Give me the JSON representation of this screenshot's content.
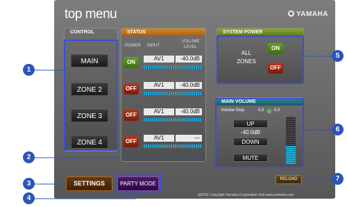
{
  "app": {
    "title": "top menu",
    "brand": "YAMAHA"
  },
  "control": {
    "title": "CONTROL",
    "zones": [
      "MAIN",
      "ZONE 2",
      "ZONE 3",
      "ZONE 4"
    ]
  },
  "status": {
    "title": "STATUS",
    "headers": {
      "power": "POWER",
      "input": "INPUT",
      "volume": "VOLUME",
      "level": "LEVEL"
    },
    "rows": [
      {
        "power": "ON",
        "input": "AV1",
        "volume": "-40.0dB"
      },
      {
        "power": "OFF",
        "input": "AV1",
        "volume": "-40.0dB"
      },
      {
        "power": "OFF",
        "input": "AV1",
        "volume": "-40.0dB"
      },
      {
        "power": "OFF",
        "input": "AV1",
        "volume": "---"
      }
    ]
  },
  "system_power": {
    "title": "SYSTEM POWER",
    "label_line1": "ALL",
    "label_line2": "ZONES",
    "on": "ON",
    "off": "OFF"
  },
  "main_volume": {
    "title": "MAIN VOLUME",
    "step_label": "Volume Step",
    "step_values": [
      "0.5",
      "5.0"
    ],
    "up": "UP",
    "value": "-40.0dB",
    "down": "DOWN",
    "mute": "MUTE"
  },
  "bottom": {
    "settings": "SETTINGS",
    "party_mode": "PARTY MODE",
    "reload": "RELOAD",
    "copyright": "@2011 Copyright Yamaha Corporation Visit www.yamaha.com"
  },
  "callouts": [
    "1",
    "2",
    "3",
    "4",
    "5",
    "6",
    "7"
  ],
  "colors": {
    "callout": "#2b56b8",
    "highlight": "#3b4fd3"
  }
}
